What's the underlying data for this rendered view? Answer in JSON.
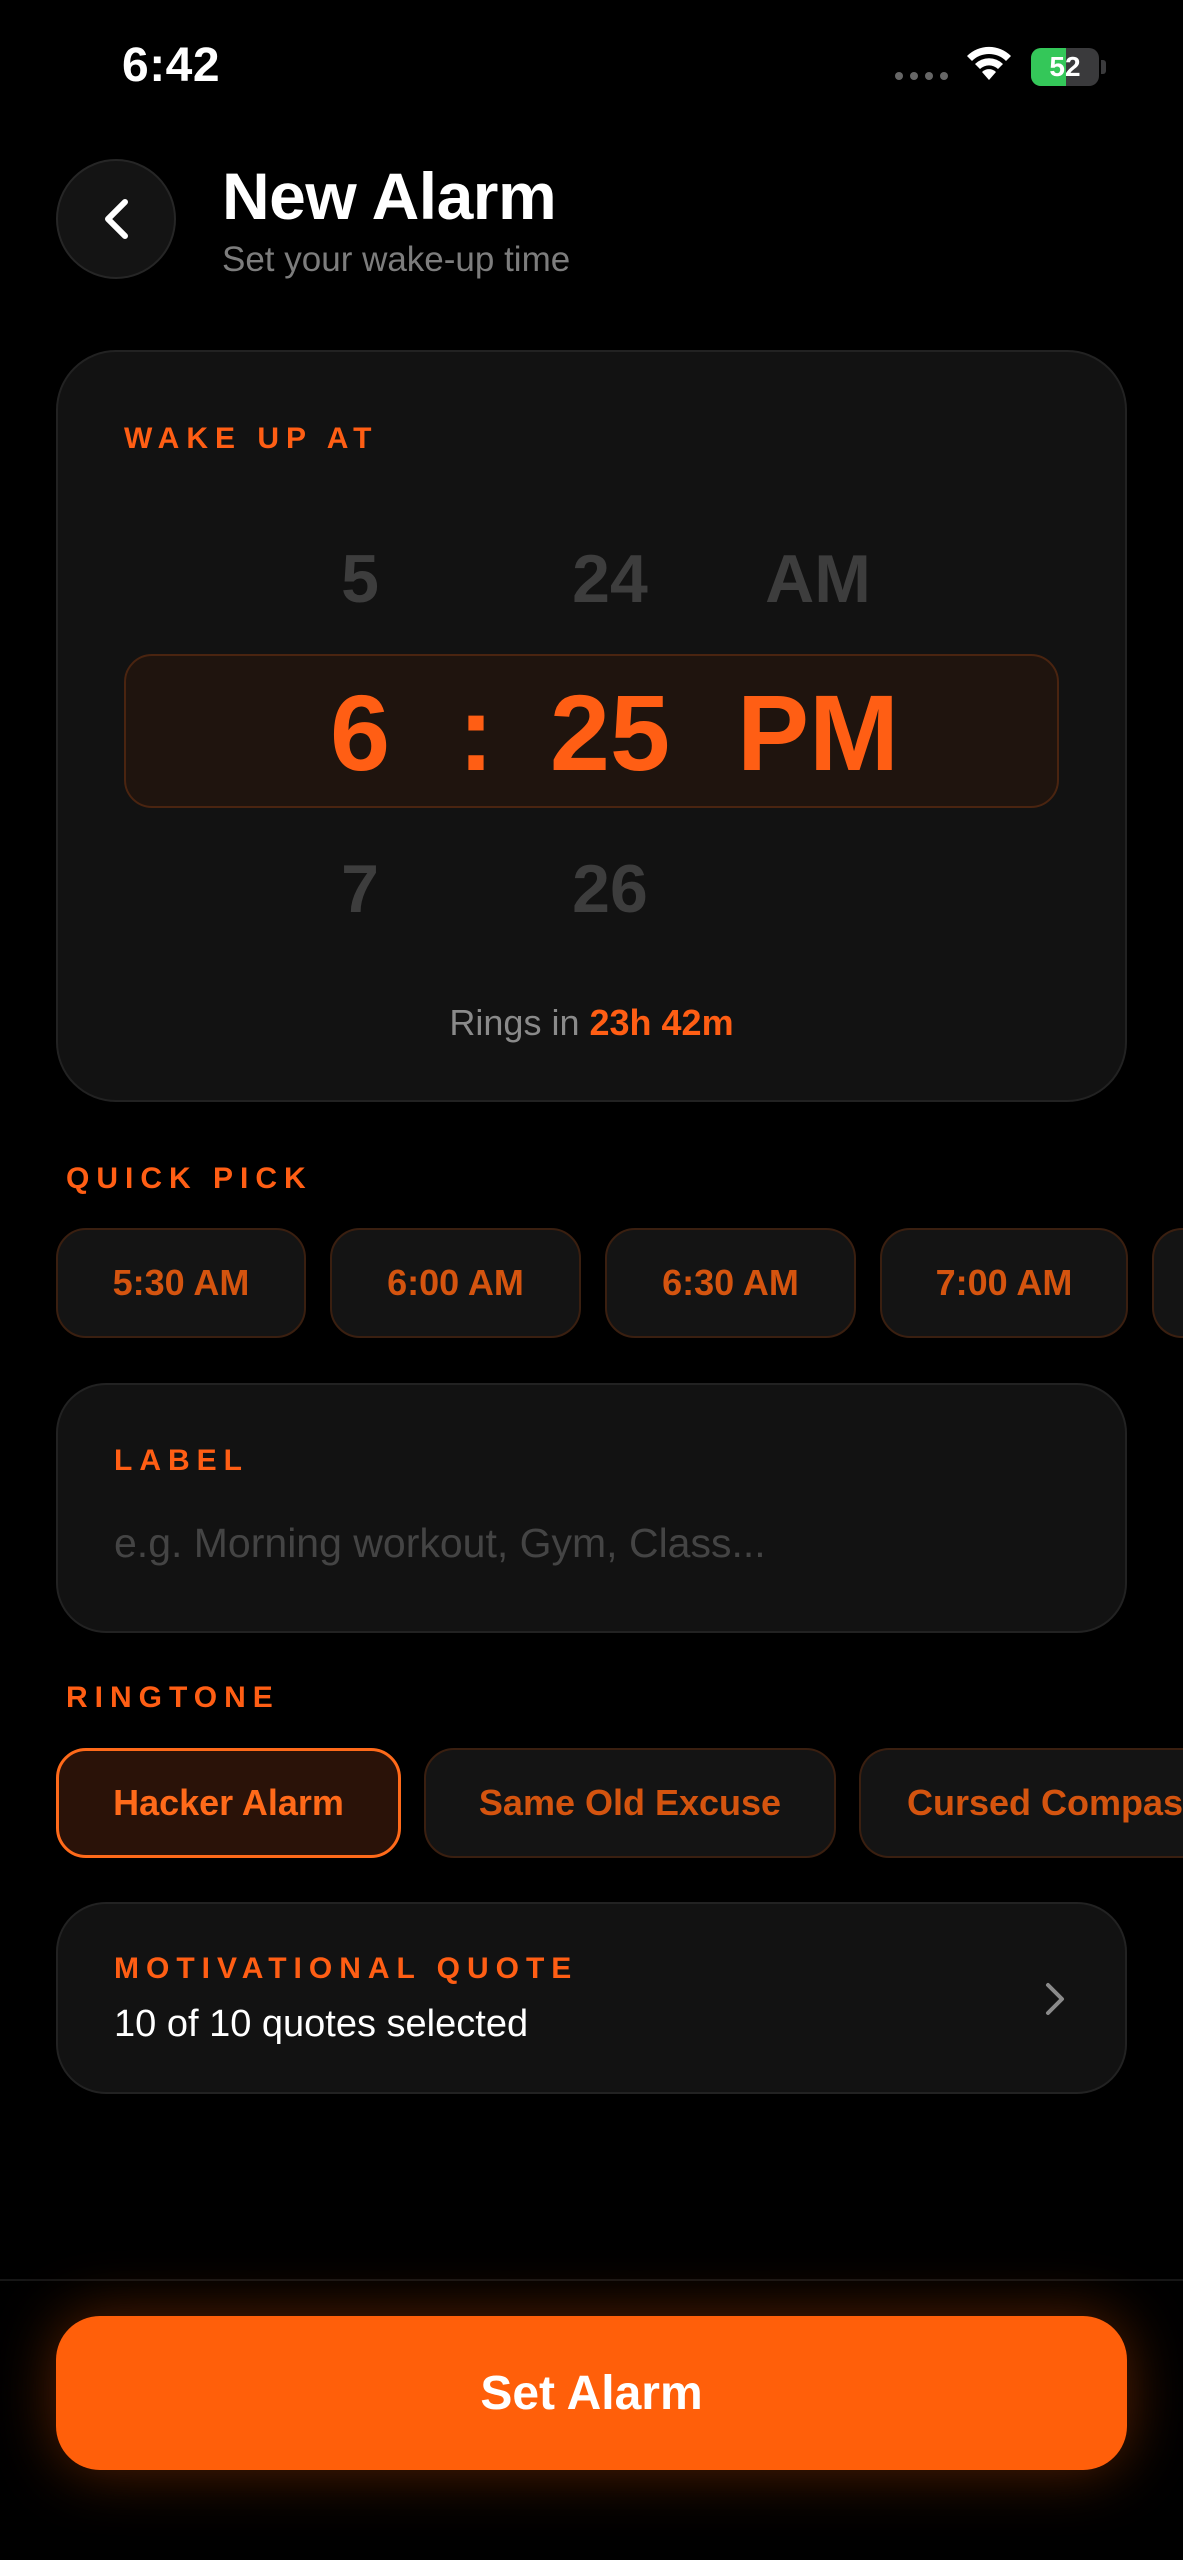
{
  "status_bar": {
    "time": "6:42",
    "battery": "52",
    "battery_level": 0.52
  },
  "header": {
    "title": "New Alarm",
    "subtitle": "Set your wake-up time"
  },
  "time_picker": {
    "section_label": "WAKE UP AT",
    "hour_above": "5",
    "minute_above": "24",
    "period_above": "AM",
    "hour": "6",
    "separator": ":",
    "minute": "25",
    "period": "PM",
    "hour_below": "7",
    "minute_below": "26",
    "rings_prefix": "Rings in",
    "rings_value": "23h 42m"
  },
  "quick_pick": {
    "section_label": "QUICK PICK",
    "options": [
      "5:30 AM",
      "6:00 AM",
      "6:30 AM",
      "7:00 AM"
    ]
  },
  "label_field": {
    "section_label": "LABEL",
    "placeholder": "e.g. Morning workout, Gym, Class..."
  },
  "ringtone": {
    "section_label": "RINGTONE",
    "options": [
      "Hacker Alarm",
      "Same Old Excuse",
      "Cursed Compass"
    ],
    "selected": "Hacker Alarm"
  },
  "quote": {
    "section_label": "MOTIVATIONAL QUOTE",
    "value": "10 of 10 quotes selected"
  },
  "actions": {
    "set_alarm_label": "Set Alarm"
  },
  "colors": {
    "accent": "#ff5e14",
    "background": "#000000",
    "card": "#121212",
    "battery_green": "#34c759"
  }
}
